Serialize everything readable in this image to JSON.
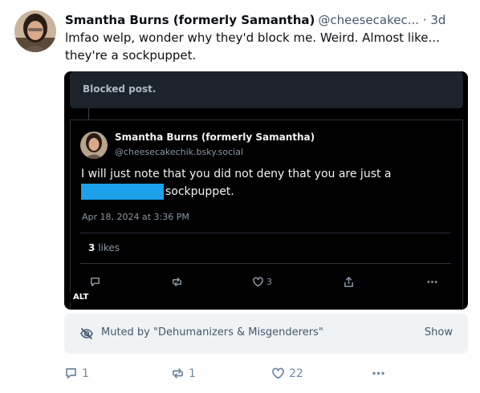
{
  "post": {
    "author_name": "Smantha Burns (formerly Samantha)",
    "author_handle": "@cheesecakec...",
    "dot": "·",
    "time": "3d",
    "text": "lmfao welp, wonder why they'd block me. Weird. Almost like... they're a sockpuppet."
  },
  "screenshot": {
    "blocked_label": "Blocked post.",
    "quote_author_name": "Smantha Burns (formerly Samantha)",
    "quote_author_handle": "@cheesecakechik.bsky.social",
    "quote_text_line1": "I will just note that you did not deny that you are just a",
    "quote_text_line2": "sockpuppet.",
    "quote_date": "Apr 18, 2024 at 3:36 PM",
    "likes_count": "3",
    "likes_label": "likes",
    "like_count_small": "3",
    "alt_label": "ALT",
    "redaction_color": "#1ca1ea"
  },
  "muted": {
    "text": "Muted by \"Dehumanizers & Misgenderers\"",
    "show_label": "Show",
    "icon": "eye-slash-icon"
  },
  "actions": {
    "reply_count": "1",
    "repost_count": "1",
    "like_count": "22",
    "icons": [
      "reply-icon",
      "repost-icon",
      "like-icon",
      "more-icon"
    ]
  },
  "colors": {
    "text": "#0b0f14",
    "secondary": "#42576c",
    "action": "#6f869f",
    "muted_bg": "#f0f3f6"
  }
}
